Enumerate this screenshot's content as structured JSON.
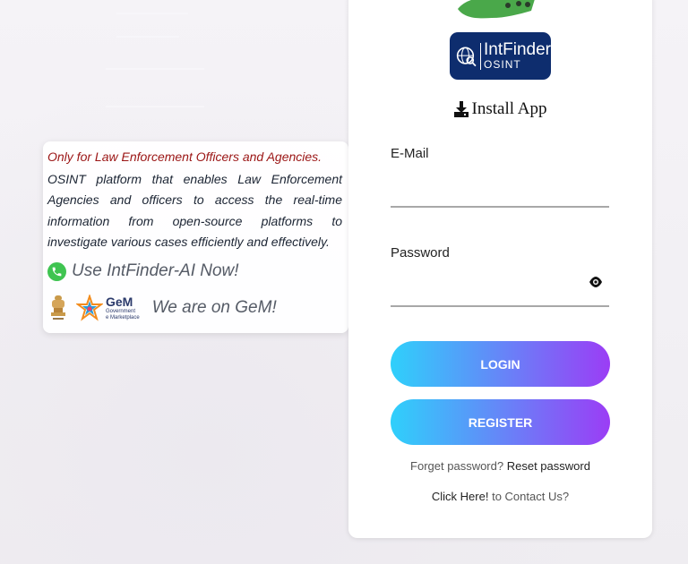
{
  "info": {
    "title": "Only for Law Enforcement Officers and Agencies.",
    "description": "OSINT platform that enables Law Enforcement Agencies and officers to access the real-time information from open-source platforms to investigate various cases efficiently and effectively.",
    "whatsapp_text": "Use IntFinder-AI Now!",
    "gem_name": "GeM",
    "gem_sub_1": "Government",
    "gem_sub_2": "e Marketplace",
    "gem_text": "We are on GeM!"
  },
  "login": {
    "logo_name": "IntFinder",
    "logo_sub": "OSINT",
    "install_label": "Install App",
    "email_label": "E-Mail",
    "email_value": "",
    "password_label": "Password",
    "password_value": "",
    "login_button": "LOGIN",
    "register_button": "REGISTER",
    "forgot_prefix": "Forget password?",
    "forgot_link": "Reset password",
    "contact_link": "Click Here!",
    "contact_suffix": "to Contact Us?"
  },
  "icons": {
    "whatsapp": "whatsapp-icon",
    "emblem": "national-emblem-icon",
    "gem_star": "gem-star-icon",
    "download": "download-icon",
    "eye": "eye-icon",
    "globe": "globe-search-icon"
  },
  "colors": {
    "title_red": "#9b1515",
    "logo_navy": "#0e2d6e",
    "button_gradient_start": "#2fd0fb",
    "button_gradient_end": "#9b3df5",
    "whatsapp_green": "#3fc451"
  }
}
